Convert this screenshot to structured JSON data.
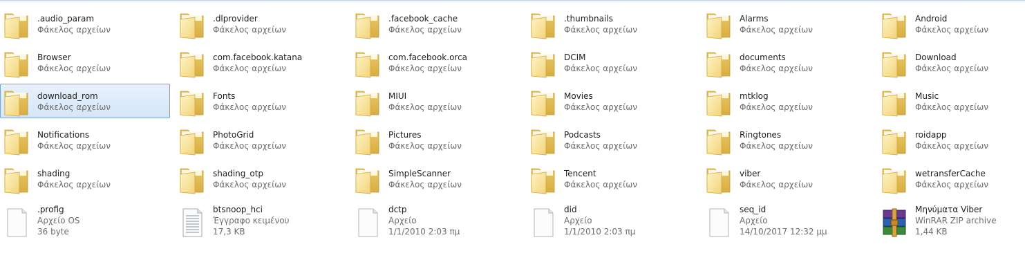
{
  "folders": [
    {
      "name": ".audio_param",
      "type": "Φάκελος αρχείων"
    },
    {
      "name": ".dlprovider",
      "type": "Φάκελος αρχείων"
    },
    {
      "name": ".facebook_cache",
      "type": "Φάκελος αρχείων"
    },
    {
      "name": ".thumbnails",
      "type": "Φάκελος αρχείων"
    },
    {
      "name": "Alarms",
      "type": "Φάκελος αρχείων"
    },
    {
      "name": "Android",
      "type": "Φάκελος αρχείων"
    },
    {
      "name": "Browser",
      "type": "Φάκελος αρχείων"
    },
    {
      "name": "com.facebook.katana",
      "type": "Φάκελος αρχείων"
    },
    {
      "name": "com.facebook.orca",
      "type": "Φάκελος αρχείων"
    },
    {
      "name": "DCIM",
      "type": "Φάκελος αρχείων"
    },
    {
      "name": "documents",
      "type": "Φάκελος αρχείων"
    },
    {
      "name": "Download",
      "type": "Φάκελος αρχείων"
    },
    {
      "name": "download_rom",
      "type": "Φάκελος αρχείων",
      "selected": true
    },
    {
      "name": "Fonts",
      "type": "Φάκελος αρχείων"
    },
    {
      "name": "MIUI",
      "type": "Φάκελος αρχείων"
    },
    {
      "name": "Movies",
      "type": "Φάκελος αρχείων"
    },
    {
      "name": "mtklog",
      "type": "Φάκελος αρχείων"
    },
    {
      "name": "Music",
      "type": "Φάκελος αρχείων"
    },
    {
      "name": "Notifications",
      "type": "Φάκελος αρχείων"
    },
    {
      "name": "PhotoGrid",
      "type": "Φάκελος αρχείων"
    },
    {
      "name": "Pictures",
      "type": "Φάκελος αρχείων"
    },
    {
      "name": "Podcasts",
      "type": "Φάκελος αρχείων"
    },
    {
      "name": "Ringtones",
      "type": "Φάκελος αρχείων"
    },
    {
      "name": "roidapp",
      "type": "Φάκελος αρχείων"
    },
    {
      "name": "shading",
      "type": "Φάκελος αρχείων"
    },
    {
      "name": "shading_otp",
      "type": "Φάκελος αρχείων"
    },
    {
      "name": "SimpleScanner",
      "type": "Φάκελος αρχείων"
    },
    {
      "name": "Tencent",
      "type": "Φάκελος αρχείων"
    },
    {
      "name": "viber",
      "type": "Φάκελος αρχείων"
    },
    {
      "name": "wetransferCache",
      "type": "Φάκελος αρχείων"
    }
  ],
  "files": [
    {
      "name": ".profig",
      "type": "Αρχείο OS",
      "detail": "36 byte",
      "icon": "blank-file-icon"
    },
    {
      "name": "btsnoop_hci",
      "type": "Έγγραφο κειμένου",
      "detail": "17,3 KB",
      "icon": "text-file-icon"
    },
    {
      "name": "dctp",
      "type": "Αρχείο",
      "detail": "1/1/2010 2:03 πμ",
      "icon": "blank-file-icon"
    },
    {
      "name": "did",
      "type": "Αρχείο",
      "detail": "1/1/2010 2:03 πμ",
      "icon": "blank-file-icon"
    },
    {
      "name": "seq_id",
      "type": "Αρχείο",
      "detail": "14/10/2017 12:32 μμ",
      "icon": "blank-file-icon"
    },
    {
      "name": "Μηνύματα Viber",
      "type": "WinRAR ZIP archive",
      "detail": "1,44 KB",
      "icon": "winrar-archive-icon"
    }
  ],
  "colors": {
    "selection_bg": "#d4e6f9",
    "selection_border": "#7da2ce",
    "secondary_text": "#6d6d6d"
  }
}
